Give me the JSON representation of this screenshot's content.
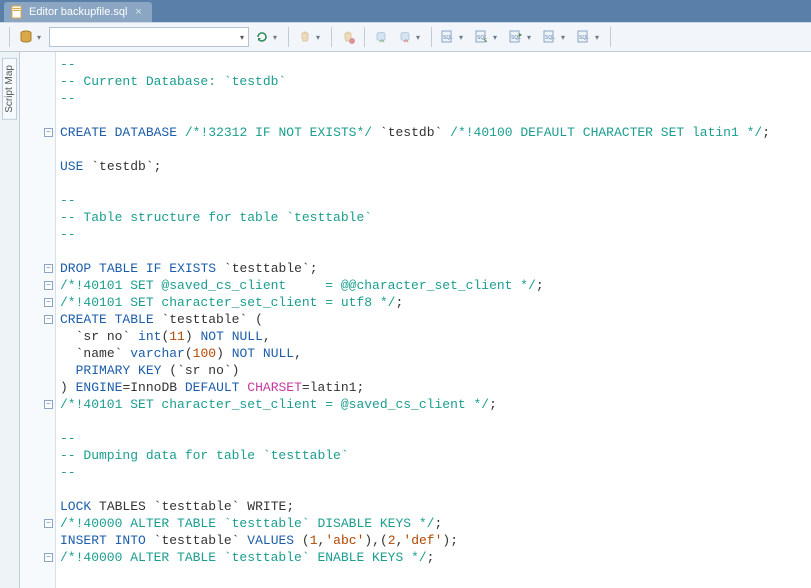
{
  "tab": {
    "title": "Editor backupfile.sql",
    "close": "×"
  },
  "toolbar": {
    "select_value": "",
    "icons": {
      "db": "db-icon",
      "refresh": "refresh-icon",
      "hand": "hand-icon",
      "hand_stop": "hand-stop-icon",
      "commit": "commit-icon",
      "rollback": "rollback-icon",
      "sql1": "sql-copy-icon",
      "sql2": "sql-paste-icon",
      "sql3": "sql-run-icon",
      "sql4": "sql-export-icon",
      "sql5": "sql-new-icon"
    }
  },
  "sidebar": {
    "tab": "Script Map"
  },
  "code": {
    "lines": [
      {
        "g": "",
        "html": "<span class='cm'>--</span>"
      },
      {
        "g": "",
        "html": "<span class='cm'>-- Current Database: `testdb`</span>"
      },
      {
        "g": "",
        "html": "<span class='cm'>--</span>"
      },
      {
        "g": "",
        "html": ""
      },
      {
        "g": "⊟",
        "html": "<span class='kw'>CREATE</span> <span class='kw'>DATABASE</span> <span class='vc'>/*!32312 IF NOT EXISTS*/</span> <span class='id'>`testdb`</span> <span class='vc'>/*!40100 DEFAULT CHARACTER SET latin1 */</span><span class='op'>;</span>"
      },
      {
        "g": "",
        "html": ""
      },
      {
        "g": "",
        "html": "<span class='kw'>USE</span> <span class='id'>`testdb`</span><span class='op'>;</span>"
      },
      {
        "g": "",
        "html": ""
      },
      {
        "g": "",
        "html": "<span class='cm'>--</span>"
      },
      {
        "g": "",
        "html": "<span class='cm'>-- Table structure for table `testtable`</span>"
      },
      {
        "g": "",
        "html": "<span class='cm'>--</span>"
      },
      {
        "g": "",
        "html": ""
      },
      {
        "g": "⊟",
        "html": "<span class='kw'>DROP</span> <span class='kw'>TABLE</span> <span class='kw'>IF</span> <span class='kw'>EXISTS</span> <span class='id'>`testtable`</span><span class='op'>;</span>"
      },
      {
        "g": "⊟",
        "html": "<span class='vc'>/*!40101 SET @saved_cs_client     = @@character_set_client */</span><span class='op'>;</span>"
      },
      {
        "g": "⊟",
        "html": "<span class='vc'>/*!40101 SET character_set_client = utf8 */</span><span class='op'>;</span>"
      },
      {
        "g": "⊟",
        "html": "<span class='kw'>CREATE</span> <span class='kw'>TABLE</span> <span class='id'>`testtable`</span> <span class='op'>(</span>"
      },
      {
        "g": "",
        "html": "  <span class='id'>`sr no`</span> <span class='kw'>int</span><span class='op'>(</span><span class='num'>11</span><span class='op'>)</span> <span class='kw'>NOT</span> <span class='kw'>NULL</span><span class='op'>,</span>"
      },
      {
        "g": "",
        "html": "  <span class='id'>`name`</span> <span class='kw'>varchar</span><span class='op'>(</span><span class='num'>100</span><span class='op'>)</span> <span class='kw'>NOT</span> <span class='kw'>NULL</span><span class='op'>,</span>"
      },
      {
        "g": "",
        "html": "  <span class='kw'>PRIMARY</span> <span class='kw'>KEY</span> <span class='op'>(</span><span class='id'>`sr no`</span><span class='op'>)</span>"
      },
      {
        "g": "",
        "html": "<span class='op'>)</span> <span class='kw'>ENGINE</span><span class='op'>=</span><span class='id'>InnoDB</span> <span class='kw'>DEFAULT</span> <span class='fn'>CHARSET</span><span class='op'>=</span><span class='id'>latin1</span><span class='op'>;</span>"
      },
      {
        "g": "⊟",
        "html": "<span class='vc'>/*!40101 SET character_set_client = @saved_cs_client */</span><span class='op'>;</span>"
      },
      {
        "g": "",
        "html": ""
      },
      {
        "g": "",
        "html": "<span class='cm'>--</span>"
      },
      {
        "g": "",
        "html": "<span class='cm'>-- Dumping data for table `testtable`</span>"
      },
      {
        "g": "",
        "html": "<span class='cm'>--</span>"
      },
      {
        "g": "",
        "html": ""
      },
      {
        "g": "",
        "html": "<span class='kw'>LOCK</span> <span class='id'>TABLES</span> <span class='id'>`testtable`</span> <span class='id'>WRITE</span><span class='op'>;</span>"
      },
      {
        "g": "⊟",
        "html": "<span class='vc'>/*!40000 ALTER TABLE `testtable` DISABLE KEYS */</span><span class='op'>;</span>"
      },
      {
        "g": "",
        "html": "<span class='kw'>INSERT</span> <span class='kw'>INTO</span> <span class='id'>`testtable`</span> <span class='kw'>VALUES</span> <span class='op'>(</span><span class='num'>1</span><span class='op'>,</span><span class='str'>'abc'</span><span class='op'>),(</span><span class='num'>2</span><span class='op'>,</span><span class='str'>'def'</span><span class='op'>);</span>"
      },
      {
        "g": "⊟",
        "html": "<span class='vc'>/*!40000 ALTER TABLE `testtable` ENABLE KEYS */</span><span class='op'>;</span>"
      }
    ]
  }
}
